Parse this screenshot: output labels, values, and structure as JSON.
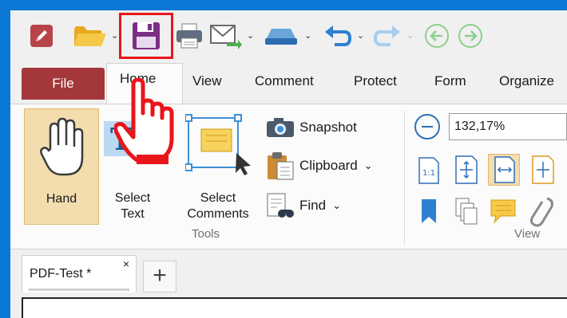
{
  "menu": {
    "tabs": [
      {
        "label": "File"
      },
      {
        "label": "Home"
      },
      {
        "label": "View"
      },
      {
        "label": "Comment"
      },
      {
        "label": "Protect"
      },
      {
        "label": "Form"
      },
      {
        "label": "Organize"
      }
    ]
  },
  "ribbon": {
    "hand": {
      "label": "Hand"
    },
    "select_text": {
      "line1": "Select",
      "line2": "Text"
    },
    "select_comments": {
      "line1": "Select",
      "line2": "Comments"
    },
    "snapshot": {
      "label": "Snapshot"
    },
    "clipboard": {
      "label": "Clipboard"
    },
    "find": {
      "label": "Find"
    },
    "tools_group": "Tools",
    "view_group": "View",
    "zoom": {
      "value": "132,17%"
    }
  },
  "document": {
    "tab_name": "PDF-Test *",
    "close_glyph": "×",
    "new_tab_glyph": "+"
  },
  "colors": {
    "window_frame": "#0a78d4",
    "file_tab": "#a4373a",
    "highlight": "#e8161b",
    "active_tool": "#f3dcae",
    "accent_blue": "#2f6fb6"
  },
  "icons": {
    "app": "app-pen-icon",
    "open": "folder-icon",
    "save": "floppy-save-icon",
    "print": "printer-icon",
    "email": "envelope-icon",
    "scan": "scanner-icon",
    "undo": "undo-arrow-icon",
    "redo": "redo-arrow-icon",
    "back": "back-circle-icon",
    "forward": "forward-circle-icon"
  }
}
